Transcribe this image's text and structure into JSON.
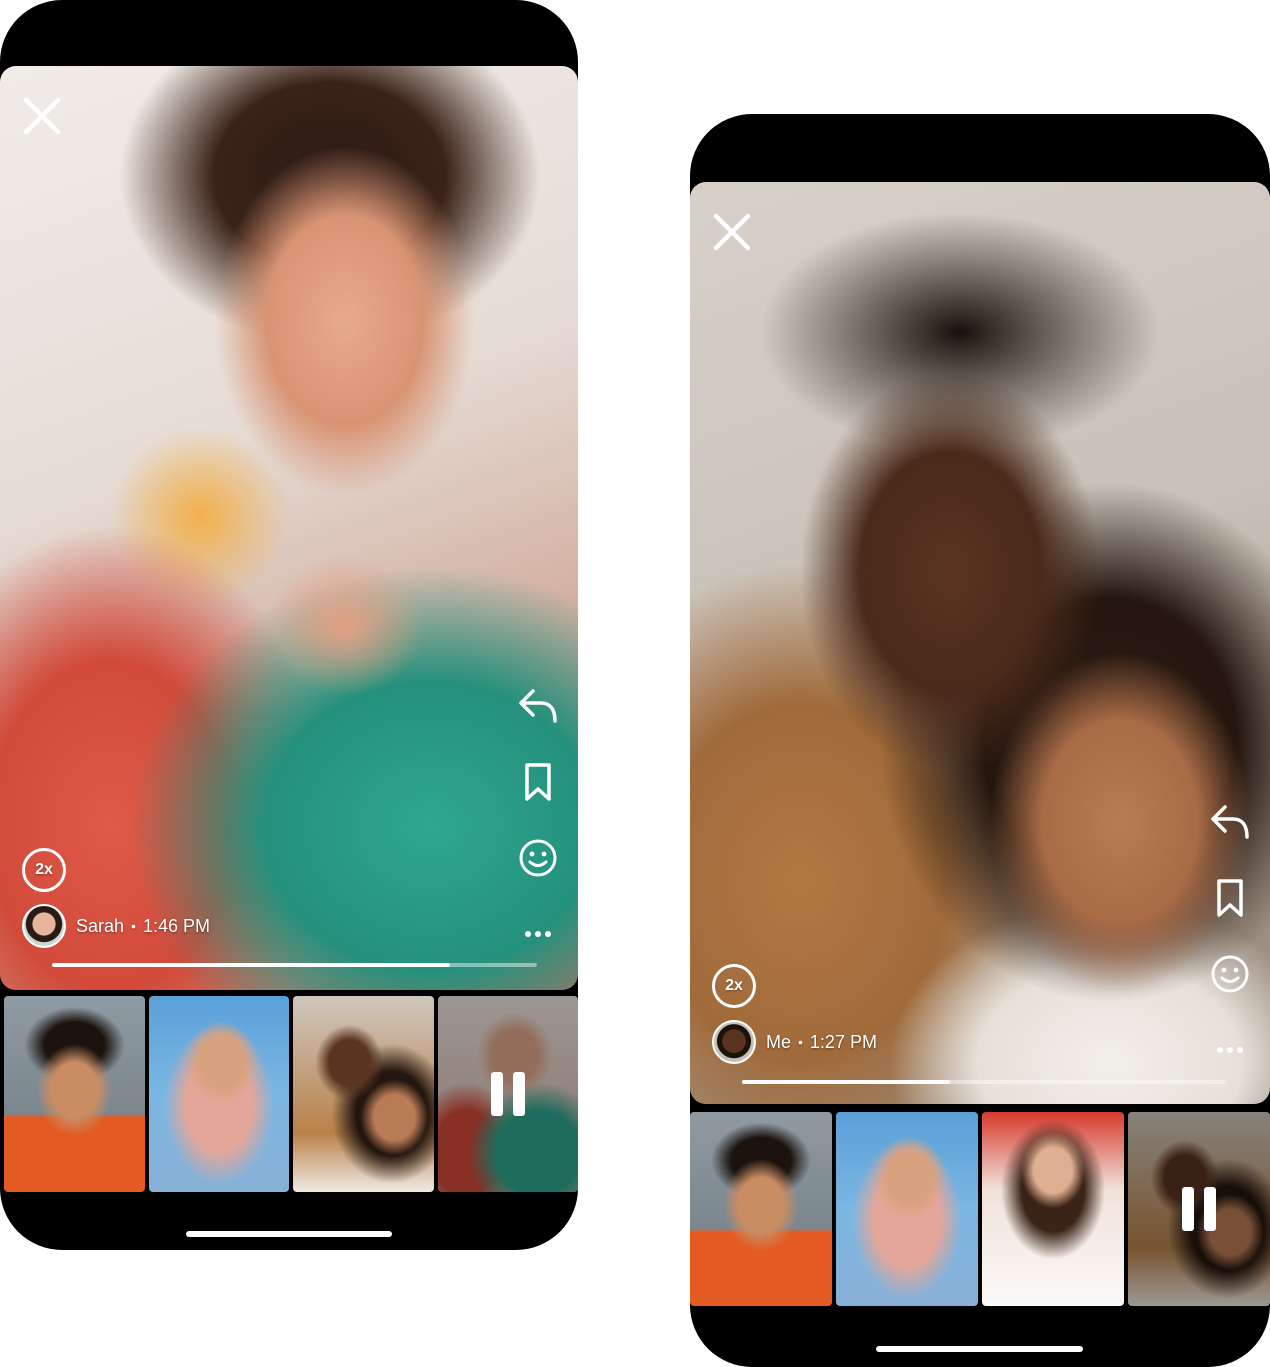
{
  "left_phone": {
    "sender": {
      "name": "Sarah",
      "separator": "•",
      "time": "1:46 PM"
    },
    "speed": "2x",
    "progress": 0.82,
    "icons": {
      "close": "close-icon",
      "reply": "reply-icon",
      "save": "bookmark-icon",
      "react": "smiley-icon",
      "more": "more-icon",
      "pause": "pause-icon"
    },
    "thumbnails": [
      {
        "name": "thumb-man-curly-hair"
      },
      {
        "name": "thumb-woman-headscarf"
      },
      {
        "name": "thumb-father-daughter"
      },
      {
        "name": "thumb-woman-green-sweater",
        "current": true
      }
    ]
  },
  "right_phone": {
    "sender": {
      "name": "Me",
      "separator": "•",
      "time": "1:27 PM"
    },
    "speed": "2x",
    "progress": 0.43,
    "icons": {
      "close": "close-icon",
      "reply": "reply-icon",
      "save": "bookmark-icon",
      "react": "smiley-icon",
      "more": "more-icon",
      "pause": "pause-icon"
    },
    "thumbnails": [
      {
        "name": "thumb-man-curly-hair"
      },
      {
        "name": "thumb-woman-headscarf"
      },
      {
        "name": "thumb-woman-long-hair"
      },
      {
        "name": "thumb-father-daughter",
        "current": true
      }
    ]
  },
  "colors": {
    "phone_frame": "#000000",
    "overlay_text": "#ffffff",
    "progress_track": "rgba(255,255,255,0.45)"
  }
}
